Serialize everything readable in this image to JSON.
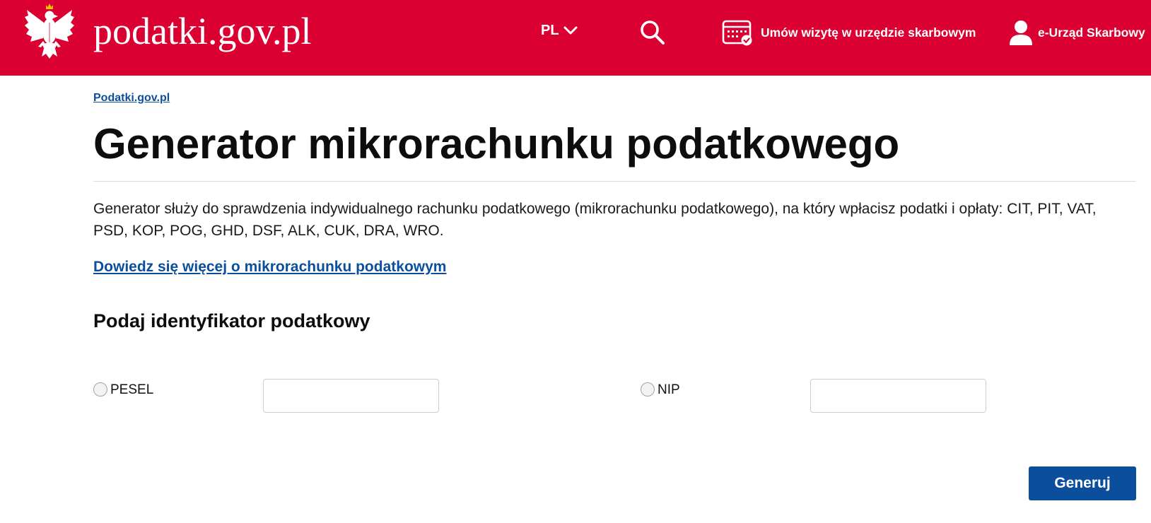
{
  "header": {
    "site_name": "podatki.gov.pl",
    "language": "PL",
    "appointment_label": "Umów wizytę w urzędzie skarbowym",
    "eurzad_label": "e-Urząd Skarbowy",
    "icons": {
      "logo": "white-eagle-emblem",
      "language_toggle": "chevron-down-icon",
      "search": "search-icon",
      "appointment": "calendar-check-icon",
      "account": "user-icon"
    }
  },
  "breadcrumb": {
    "home": "Podatki.gov.pl"
  },
  "page": {
    "title": "Generator mikrorachunku podatkowego",
    "description": "Generator służy do sprawdzenia indywidualnego rachunku podatkowego (mikrorachunku podatkowego), na który wpłacisz podatki i opłaty: CIT, PIT, VAT, PSD, KOP, POG, GHD, DSF, ALK, CUK, DRA, WRO.",
    "learn_more_link": "Dowiedz się więcej o mikrorachunku podatkowym"
  },
  "form": {
    "heading": "Podaj identyfikator podatkowy",
    "options": [
      {
        "label": "PESEL",
        "selected": false,
        "value": "",
        "placeholder": ""
      },
      {
        "label": "NIP",
        "selected": false,
        "value": "",
        "placeholder": ""
      }
    ],
    "submit_label": "Generuj"
  },
  "colors": {
    "header_bg": "#db0032",
    "link": "#0b4f9c",
    "button_bg": "#0b4f9c",
    "crown": "#f2c200"
  }
}
